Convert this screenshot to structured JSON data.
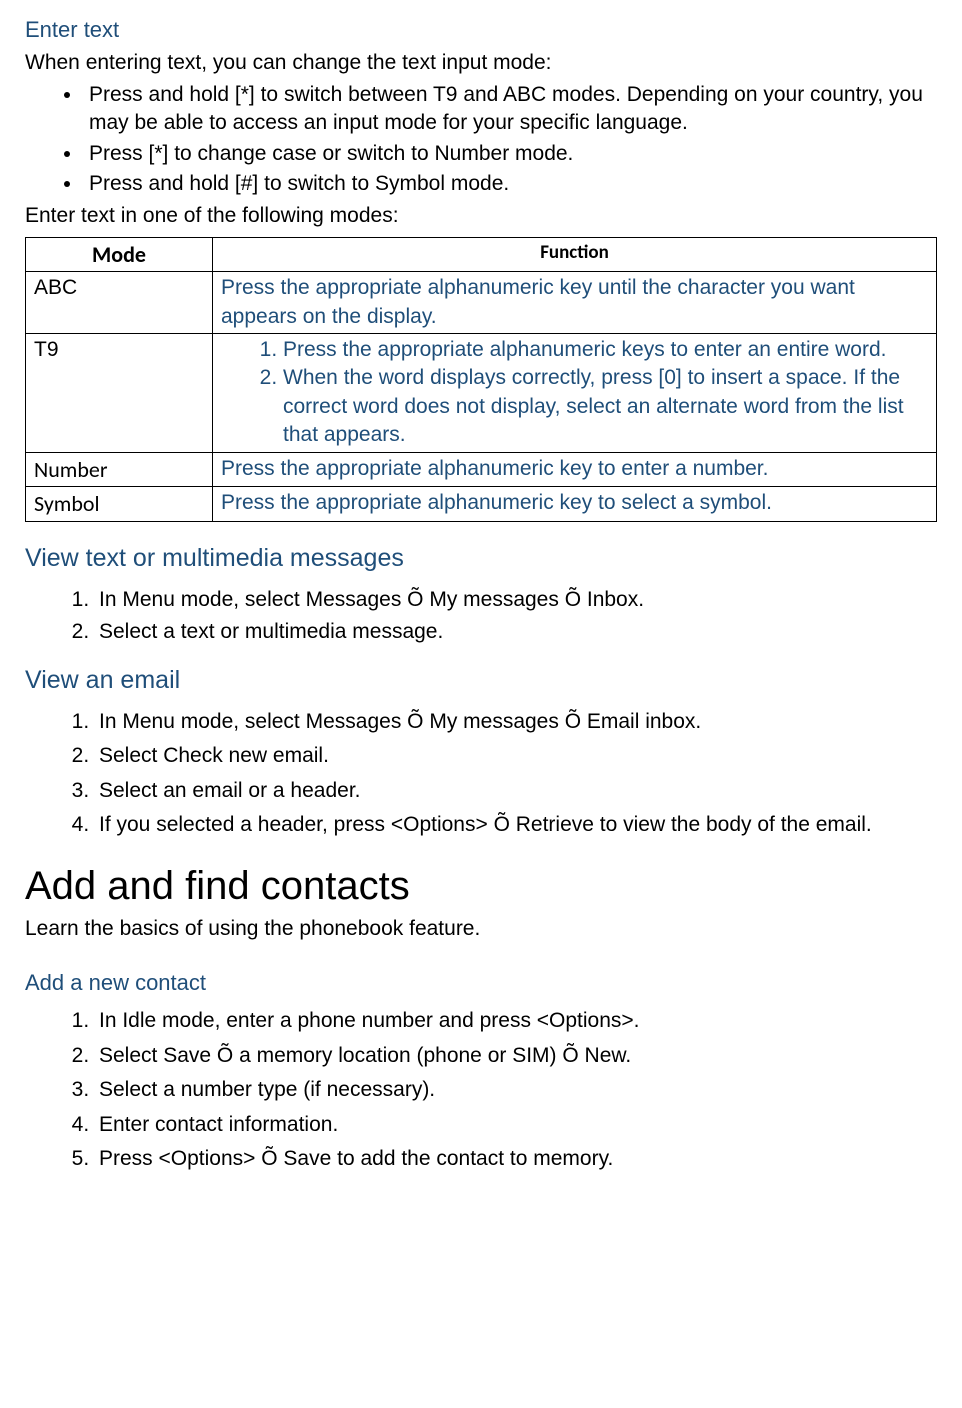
{
  "sec1": {
    "title": "Enter text",
    "intro": "When entering text, you can change the text input mode:",
    "bullets": [
      "Press and hold [*] to switch between T9 and ABC modes. Depending on your country, you may be able to access an input mode for your specific language.",
      "Press [*] to change case or switch to Number mode.",
      "Press and hold [#] to switch to Symbol mode."
    ],
    "table_intro": "Enter text in one of the following modes:",
    "table": {
      "h_mode": "Mode",
      "h_func": "Function",
      "r_abc_mode": "ABC",
      "r_abc_func": "Press the appropriate alphanumeric key until the character you want appears on the display.",
      "r_t9_mode": "T9",
      "r_t9_func1": "Press the appropriate alphanumeric keys to enter an entire word.",
      "r_t9_func2": "When the word displays correctly, press [0] to insert a space. If the correct word does not display, select an alternate word from the list that appears.",
      "r_num_mode": "Number",
      "r_num_func": "Press the appropriate alphanumeric key to enter a number.",
      "r_sym_mode": "Symbol",
      "r_sym_func": "Press the appropriate alphanumeric key to select a symbol."
    }
  },
  "sec2": {
    "title": "View text or multimedia messages",
    "steps": [
      "In Menu mode, select Messages Õ My messages Õ Inbox.",
      "Select a text or multimedia message."
    ]
  },
  "sec3": {
    "title": "View an email",
    "steps": [
      "In Menu mode, select Messages Õ My messages Õ Email inbox.",
      "Select Check new email.",
      "Select an email or a header.",
      "If you selected a header, press <Options> Õ Retrieve to view the body of the email."
    ]
  },
  "sec4": {
    "title": "Add and find contacts",
    "intro": "Learn the basics of using the phonebook feature."
  },
  "sec5": {
    "title": "Add a new contact",
    "steps": [
      "In Idle mode, enter a phone number and press <Options>.",
      "Select Save Õ a memory location (phone or SIM) Õ New.",
      "Select a number type (if necessary).",
      "Enter contact information.",
      "Press <Options> Õ Save to add the contact to memory."
    ]
  }
}
